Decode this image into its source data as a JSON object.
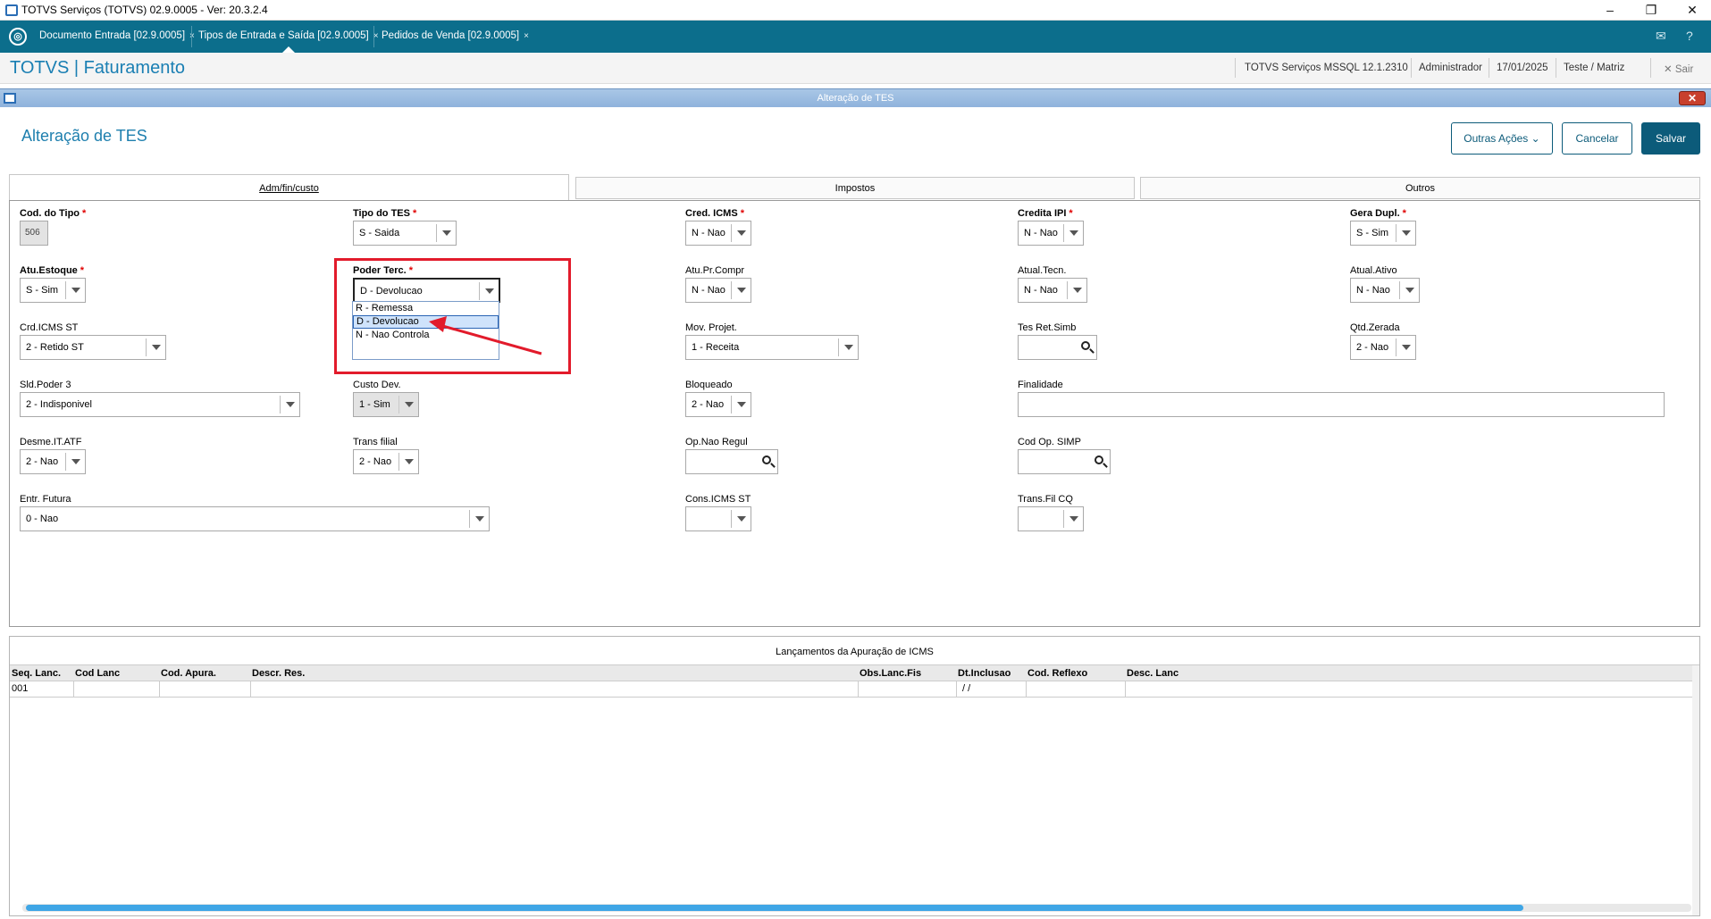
{
  "window": {
    "title": "TOTVS Serviços (TOTVS) 02.9.0005 - Ver: 20.3.2.4",
    "controls": [
      "–",
      "❐",
      "✕"
    ]
  },
  "tabs": [
    {
      "label": "Documento Entrada [02.9.0005]",
      "close": "×"
    },
    {
      "label": "Tipos de Entrada e Saída [02.9.0005]",
      "close": "×",
      "active": true
    },
    {
      "label": "Pedidos de Venda [02.9.0005]",
      "close": "×"
    }
  ],
  "header": {
    "app_title": "TOTVS | Faturamento",
    "environment": "TOTVS Serviços MSSQL 12.1.2310",
    "user": "Administrador",
    "date": "17/01/2025",
    "branch": "Teste / Matriz",
    "exit_label": "Sair"
  },
  "dialog": {
    "bar_title": "Alteração de TES",
    "title": "Alteração de TES",
    "other_actions": "Outras Ações",
    "cancel": "Cancelar",
    "save": "Salvar"
  },
  "form_tabs": [
    "Adm/fin/custo",
    "Impostos",
    "Outros"
  ],
  "fields": {
    "cod_tipo": {
      "label": "Cod. do Tipo",
      "value": "506"
    },
    "tipo_tes": {
      "label": "Tipo do TES",
      "value": "S - Saida"
    },
    "cred_icms": {
      "label": "Cred. ICMS",
      "value": "N - Nao"
    },
    "credita_ipi": {
      "label": "Credita IPI",
      "value": "N - Nao"
    },
    "gera_dupl": {
      "label": "Gera Dupl.",
      "value": "S - Sim"
    },
    "atu_estoque": {
      "label": "Atu.Estoque",
      "value": "S - Sim"
    },
    "poder_terc": {
      "label": "Poder Terc.",
      "value": "D - Devolucao"
    },
    "atu_pr_compr": {
      "label": "Atu.Pr.Compr",
      "value": "N - Nao"
    },
    "atual_tecn": {
      "label": "Atual.Tecn.",
      "value": "N - Nao"
    },
    "atual_ativo": {
      "label": "Atual.Ativo",
      "value": "N - Nao"
    },
    "crd_icms_st": {
      "label": "Crd.ICMS ST",
      "value": "2 - Retido ST"
    },
    "mov_projet": {
      "label": "Mov. Projet.",
      "value": "1 - Receita"
    },
    "tes_ret_simb": {
      "label": "Tes Ret.Simb",
      "value": ""
    },
    "qtd_zerada": {
      "label": "Qtd.Zerada",
      "value": "2 - Nao"
    },
    "sld_poder3": {
      "label": "Sld.Poder 3",
      "value": "2 - Indisponivel"
    },
    "custo_dev": {
      "label": "Custo Dev.",
      "value": "1 - Sim"
    },
    "bloqueado": {
      "label": "Bloqueado",
      "value": "2 - Nao"
    },
    "finalidade": {
      "label": "Finalidade",
      "value": ""
    },
    "desme_it_atf": {
      "label": "Desme.IT.ATF",
      "value": "2 - Nao"
    },
    "trans_filial": {
      "label": "Trans filial",
      "value": "2 - Nao"
    },
    "op_nao_regul": {
      "label": "Op.Nao Regul",
      "value": ""
    },
    "cod_op_simp": {
      "label": "Cod Op. SIMP",
      "value": ""
    },
    "entr_futura": {
      "label": "Entr. Futura",
      "value": "0 - Nao"
    },
    "cons_icms_st": {
      "label": "Cons.ICMS ST",
      "value": ""
    },
    "trans_fil_cq": {
      "label": "Trans.Fil CQ",
      "value": ""
    }
  },
  "required_mark": "*",
  "dropdown_options": [
    "R - Remessa",
    "D - Devolucao",
    "N - Nao Controla"
  ],
  "grid": {
    "title": "Lançamentos da Apuração de ICMS",
    "columns": [
      "Seq. Lanc.",
      "Cod Lanc",
      "Cod. Apura.",
      "Descr. Res.",
      "Obs.Lanc.Fis",
      "Dt.Inclusao",
      "Cod. Reflexo",
      "Desc. Lanc"
    ],
    "rows": [
      [
        "001",
        "",
        "",
        "",
        "",
        " /  / ",
        "",
        ""
      ]
    ]
  },
  "colors": {
    "tabbar": "#0c6e8c",
    "accent": "#1a7fb3",
    "annotation": "#e21b2b"
  }
}
